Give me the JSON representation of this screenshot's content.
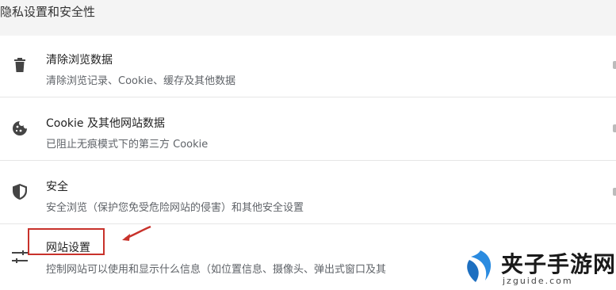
{
  "section": {
    "title": "隐私设置和安全性"
  },
  "rows": [
    {
      "icon": "trash-icon",
      "title": "清除浏览数据",
      "desc": "清除浏览记录、Cookie、缓存及其他数据"
    },
    {
      "icon": "cookie-icon",
      "title": "Cookie 及其他网站数据",
      "desc": "已阻止无痕模式下的第三方 Cookie"
    },
    {
      "icon": "shield-icon",
      "title": "安全",
      "desc": "安全浏览（保护您免受危险网站的侵害）和其他安全设置"
    },
    {
      "icon": "sliders-icon",
      "title": "网站设置",
      "desc": "控制网站可以使用和显示什么信息（如位置信息、摄像头、弹出式窗口及其"
    }
  ],
  "annotation": {
    "color": "#c8322b"
  },
  "watermark": {
    "text": "夹子手游网",
    "url": "jzguide.com",
    "logo_color": "#2a8be0"
  }
}
